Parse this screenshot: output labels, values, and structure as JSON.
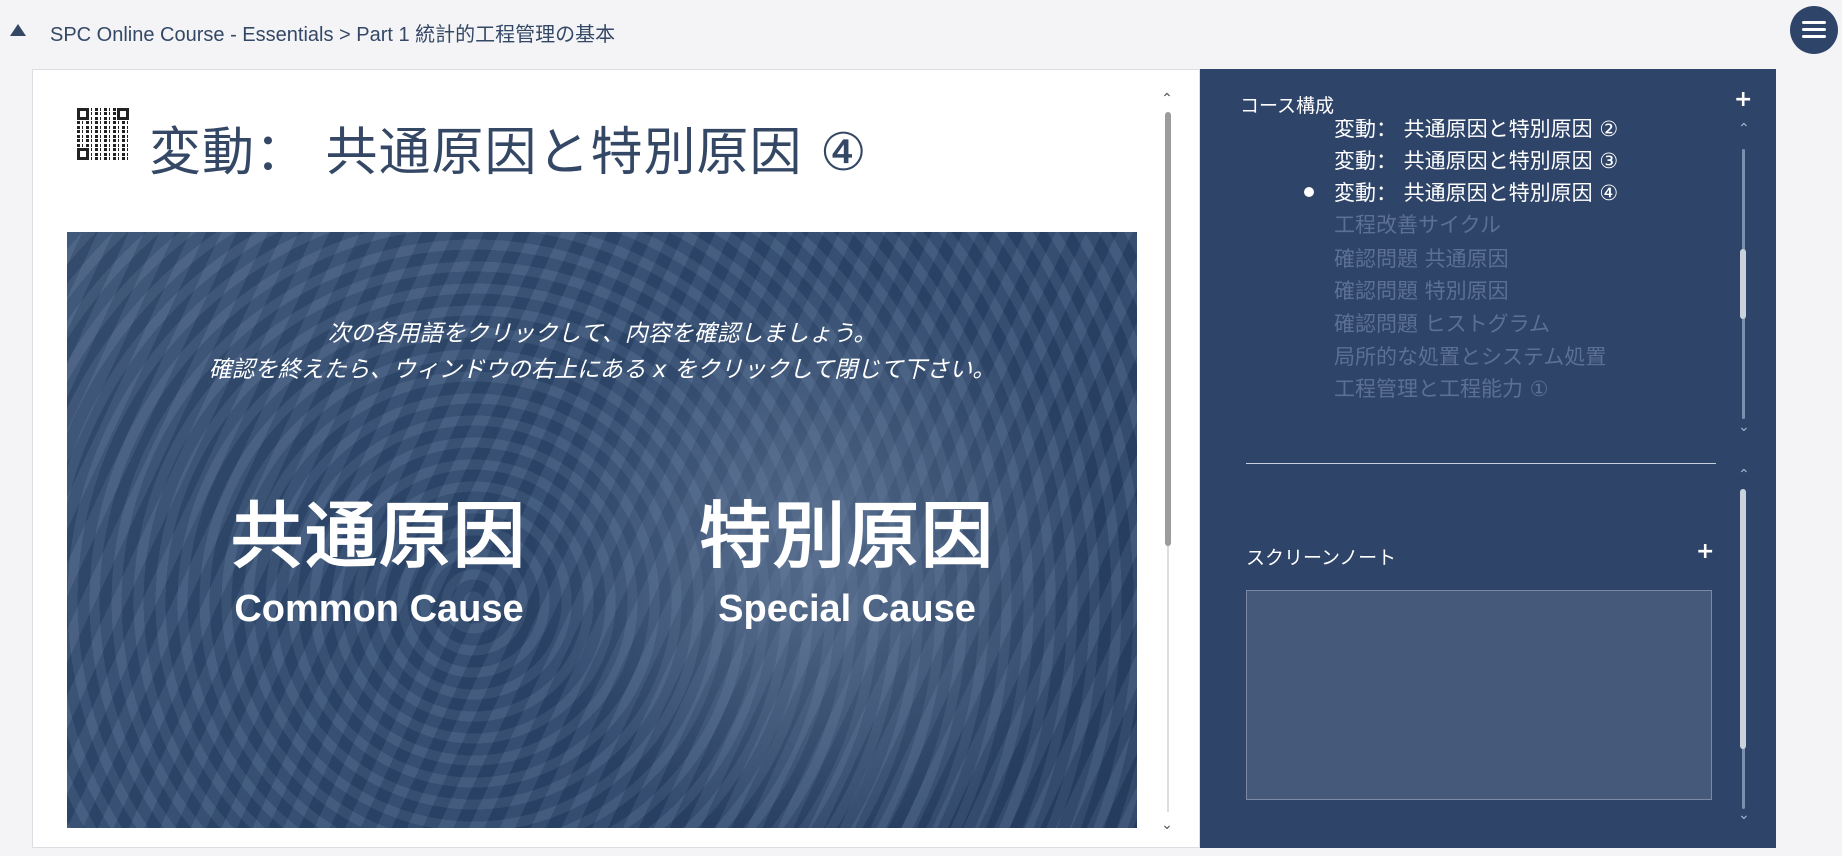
{
  "header": {
    "breadcrumb": "SPC Online Course - Essentials > Part 1 統計的工程管理の基本"
  },
  "content": {
    "title": "変動： 共通原因と特別原因 ④",
    "slide": {
      "instruction_line1": "次の各用語をクリックして、内容を確認しましょう。",
      "instruction_line2": "確認を終えたら、ウィンドウの右上にある x をクリックして閉じて下さい。",
      "terms": [
        {
          "jp": "共通原因",
          "en": "Common Cause"
        },
        {
          "jp": "特別原因",
          "en": "Special Cause"
        }
      ]
    }
  },
  "sidebar": {
    "course_structure": {
      "heading": "コース構成",
      "items": [
        {
          "label": "変動： 共通原因と特別原因 ②",
          "state": "visited"
        },
        {
          "label": "変動： 共通原因と特別原因 ③",
          "state": "visited"
        },
        {
          "label": "変動： 共通原因と特別原因 ④",
          "state": "current"
        },
        {
          "label": "工程改善サイクル",
          "state": "locked"
        },
        {
          "label": "確認問題 共通原因",
          "state": "locked"
        },
        {
          "label": "確認問題 特別原因",
          "state": "locked"
        },
        {
          "label": "確認問題 ヒストグラム",
          "state": "locked"
        },
        {
          "label": "局所的な処置とシステム処置",
          "state": "locked"
        },
        {
          "label": "工程管理と工程能力 ①",
          "state": "locked"
        }
      ]
    },
    "screen_notes": {
      "heading": "スクリーンノート",
      "value": ""
    },
    "plus_symbol": "+"
  },
  "colors": {
    "sidebar_bg": "#2f4469",
    "title_text": "#344866",
    "locked_item": "#5c7096"
  }
}
